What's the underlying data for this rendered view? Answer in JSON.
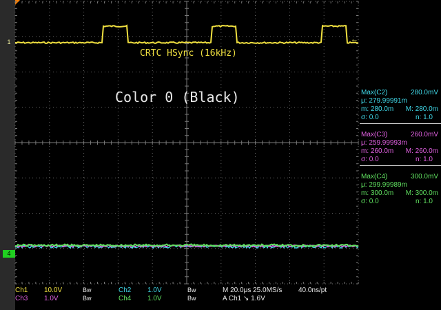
{
  "overlay": {
    "title": "CRTC HSync (16kHz)",
    "subtitle": "Color 0 (Black)"
  },
  "markers": {
    "ch1": "1",
    "ch4": "4",
    "trigger_level": "←"
  },
  "measurements": [
    {
      "label": "Max(C2)",
      "value": "280.0mV",
      "mu_label": "μ:",
      "mu": "279.99991m",
      "m_label": "m:",
      "m": "280.0m",
      "M_label": "M:",
      "M": "280.0m",
      "sigma_label": "σ:",
      "sigma": "0.0",
      "n_label": "n:",
      "n": "1.0",
      "color": "#40d8e8"
    },
    {
      "label": "Max(C3)",
      "value": "260.0mV",
      "mu_label": "μ:",
      "mu": "259.99993m",
      "m_label": "m:",
      "m": "260.0m",
      "M_label": "M:",
      "M": "260.0m",
      "sigma_label": "σ:",
      "sigma": "0.0",
      "n_label": "n:",
      "n": "1.0",
      "color": "#e060e0"
    },
    {
      "label": "Max(C4)",
      "value": "300.0mV",
      "mu_label": "μ:",
      "mu": "299.99989m",
      "m_label": "m:",
      "m": "300.0m",
      "M_label": "M:",
      "M": "300.0m",
      "sigma_label": "σ:",
      "sigma": "0.0",
      "n_label": "n:",
      "n": "1.0",
      "color": "#60e060"
    }
  ],
  "status": {
    "ch1_label": "Ch1",
    "ch1_scale": "10.0V",
    "ch1_bw": "Bw",
    "ch2_label": "Ch2",
    "ch2_scale": "1.0V",
    "ch2_bw": "Bw",
    "ch3_label": "Ch3",
    "ch3_scale": "1.0V",
    "ch3_bw": "Bw",
    "ch4_label": "Ch4",
    "ch4_scale": "1.0V",
    "ch4_bw": "Bw",
    "timebase": "M 20.0μs 25.0MS/s",
    "resolution": "40.0ns/pt",
    "trigger": "A  Ch1  ↘  1.6V"
  },
  "colors": {
    "ch1": "#f0e040",
    "ch2": "#40d8e8",
    "ch3": "#e060e0",
    "ch4": "#60e060",
    "grid": "#6a6a6a"
  }
}
